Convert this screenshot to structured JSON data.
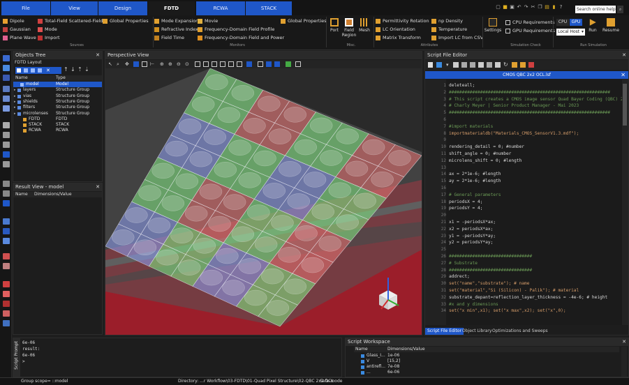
{
  "top_tabs": [
    {
      "label": "File",
      "type": "blue"
    },
    {
      "label": "View",
      "type": "blue"
    },
    {
      "label": "Design",
      "type": "blue"
    },
    {
      "label": "FDTD",
      "type": "active"
    },
    {
      "label": "RCWA",
      "type": "blue"
    },
    {
      "label": "STACK",
      "type": "blue"
    }
  ],
  "search_placeholder": "Search online help",
  "ribbon": {
    "sources": {
      "items": [
        "Dipole",
        "Gaussian",
        "Plane Wave",
        "Total-Field Scattered-Field",
        "Mode",
        "Import"
      ],
      "extra": "Global Properties",
      "group": "Sources"
    },
    "monitors": {
      "items": [
        "Mode Expansion",
        "Refractive Index",
        "Field Time",
        "Movie",
        "Frequency-Domain Field Profile",
        "Frequency-Domain Field and Power"
      ],
      "extra": "Global Properties",
      "group": "Monitors"
    },
    "misc": {
      "items": [
        "Port",
        "Field Region",
        "Mesh"
      ],
      "group": "Misc."
    },
    "attributes": {
      "items": [
        "Permittivity Rotation",
        "LC Orientation",
        "Matrix Transform",
        "np Density",
        "Temperature",
        "Import LC from CSV"
      ],
      "group": "Attributes"
    },
    "simcheck": {
      "settings": "Settings",
      "cpu_req": "CPU Requirements",
      "gpu_req": "GPU Requirements",
      "group": "Simulation Check"
    },
    "run": {
      "cpu": "CPU",
      "gpu": "GPU",
      "host": "Local Host",
      "run": "Run",
      "resume": "Resume",
      "group": "Run Simulation"
    }
  },
  "objects_tree": {
    "title": "Objects Tree",
    "layout": "FDTD Layout",
    "headers": [
      "Name",
      "Type"
    ],
    "rows": [
      {
        "name": "model",
        "type": "Model",
        "selected": true
      },
      {
        "name": "layers",
        "type": "Structure Group"
      },
      {
        "name": "vias",
        "type": "Structure Group"
      },
      {
        "name": "shields",
        "type": "Structure Group"
      },
      {
        "name": "filters",
        "type": "Structure Group"
      },
      {
        "name": "microlenses",
        "type": "Structure Group"
      },
      {
        "name": "FDTD",
        "type": "FDTD"
      },
      {
        "name": "STACK",
        "type": "STACK"
      },
      {
        "name": "RCWA",
        "type": "RCWA"
      }
    ]
  },
  "result_view": {
    "title": "Result View - model",
    "headers": [
      "Name",
      "Dimensions/Value"
    ]
  },
  "perspective": {
    "title": "Perspective View"
  },
  "script_editor": {
    "title": "Script File Editor",
    "filename": "CMOS QBC 2x2 OCL.lsf",
    "lines": [
      {
        "n": "1",
        "t": "deleteall;",
        "c": "kw"
      },
      {
        "n": "2",
        "t": "##############################################################",
        "c": "cmt"
      },
      {
        "n": "3",
        "t": "# This script creates a CMOS image sensor Quad Bayer Coding (QBC) 2",
        "c": "cmt"
      },
      {
        "n": "4",
        "t": "# Charly Meyer | Senior Product Manager - Mai 2023",
        "c": "cmt"
      },
      {
        "n": "5",
        "t": "##############################################################",
        "c": "cmt"
      },
      {
        "n": "6",
        "t": "",
        "c": "kw"
      },
      {
        "n": "7",
        "t": "#import materials",
        "c": "cmt"
      },
      {
        "n": "8",
        "t": "importmaterialdb(\"Materials_CMOS_SensorV1.3.mdf\");",
        "c": "str"
      },
      {
        "n": "9",
        "t": "",
        "c": "kw"
      },
      {
        "n": "10",
        "t": "rendering_detail = 0; #number",
        "c": "kw"
      },
      {
        "n": "11",
        "t": "shift_angle = 0; #number",
        "c": "kw"
      },
      {
        "n": "12",
        "t": "microlens_shift = 0; #length",
        "c": "kw"
      },
      {
        "n": "13",
        "t": "",
        "c": "kw"
      },
      {
        "n": "14",
        "t": "ax = 2*1e-6; #length",
        "c": "kw"
      },
      {
        "n": "15",
        "t": "ay = 2*1e-6; #length",
        "c": "kw"
      },
      {
        "n": "16",
        "t": "",
        "c": "kw"
      },
      {
        "n": "17",
        "t": "# General parameters",
        "c": "cmt"
      },
      {
        "n": "18",
        "t": "periodsX = 4;",
        "c": "kw"
      },
      {
        "n": "19",
        "t": "periodsY = 4;",
        "c": "kw"
      },
      {
        "n": "20",
        "t": "",
        "c": "kw"
      },
      {
        "n": "21",
        "t": "x1 = -periodsX*ax;",
        "c": "kw"
      },
      {
        "n": "22",
        "t": "x2 = periodsX*ax;",
        "c": "kw"
      },
      {
        "n": "23",
        "t": "y1 = -periodsY*ay;",
        "c": "kw"
      },
      {
        "n": "24",
        "t": "y2 = periodsY*ay;",
        "c": "kw"
      },
      {
        "n": "25",
        "t": "",
        "c": "kw"
      },
      {
        "n": "26",
        "t": "################################",
        "c": "cmt"
      },
      {
        "n": "27",
        "t": "# Substrate",
        "c": "cmt"
      },
      {
        "n": "28",
        "t": "################################",
        "c": "cmt"
      },
      {
        "n": "29",
        "t": "addrect;",
        "c": "kw"
      },
      {
        "n": "30",
        "t": "set(\"name\",\"substrate\"); # name",
        "c": "str"
      },
      {
        "n": "31",
        "t": "set(\"material\",\"Si (Silicon) - Palik\"); # material",
        "c": "str"
      },
      {
        "n": "32",
        "t": "substrate_depant=reflection_layer_thickness = -4e-6; # height",
        "c": "kw"
      },
      {
        "n": "33",
        "t": "#x and y dimensions",
        "c": "cmt"
      },
      {
        "n": "34",
        "t": "set(\"x min\",x1); set(\"x max\",x2); set(\"x\",0);",
        "c": "str"
      }
    ],
    "bottom_tabs": [
      "Script File Editor",
      "Object Library",
      "Optimizations and Sweeps"
    ]
  },
  "console": {
    "title": "Script Prompt",
    "lines": [
      "6e-06",
      "result:",
      "6e-06",
      ">"
    ]
  },
  "workspace": {
    "title": "Script Workspace",
    "headers": [
      "Name",
      "Dimensions/Value"
    ],
    "rows": [
      {
        "name": "Glass_I...",
        "value": "1e-06"
      },
      {
        "name": "V",
        "value": "[15,2]"
      },
      {
        "name": "antirefl...",
        "value": "7e-08"
      },
      {
        "name": "...",
        "value": "6e-06"
      }
    ]
  },
  "status": {
    "group_scope": "Group scope= ::model",
    "directory": "Directory: ...r Workflow\\03-FDTD\\01-Quad Pixel Structure\\02-QBC 2x2 OCL",
    "mode": "Safe-mode"
  },
  "colors": {
    "accent": "#1f57c8",
    "red_filter": "#e07070",
    "green_filter": "#80e080",
    "blue_filter": "#8a9ae8",
    "substrate": "#9b1e2a"
  }
}
